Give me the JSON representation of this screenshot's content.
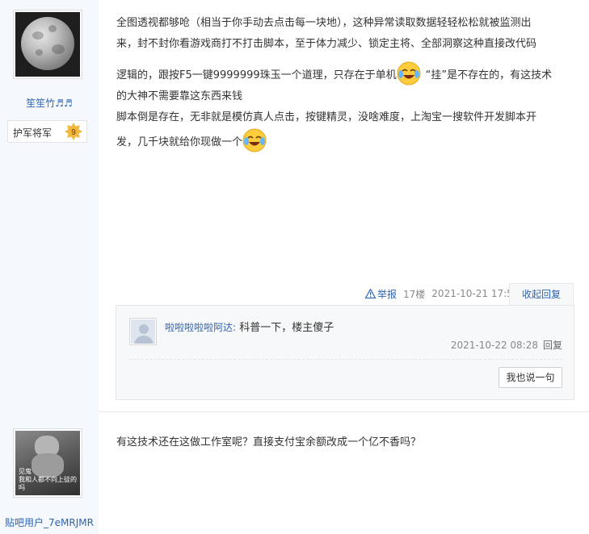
{
  "post1": {
    "username": "笙笙竹♬♬",
    "rank_title": "护军将军",
    "rank_level": "9",
    "lines": [
      "全图透视都够呛（相当于你手动去点击每一块地），这种异常读取数据轻轻松松就被监测出",
      "来，封不封你看游戏商打不打击脚本，至于体力减少、锁定主将、全部洞察这种直接改代码",
      "逻辑的，跟按F5一键9999999珠玉一个道理，只存在于单机",
      "“挂”是不存在的，有这技术",
      "的大神不需要靠这东西来钱",
      "脚本倒是存在，无非就是模仿真人点击，按键精灵，没啥难度，上淘宝一搜软件开发脚本开",
      "发，几千块就给你现做一个"
    ],
    "report_label": "举报",
    "floor": "17楼",
    "time": "2021-10-21 17:58",
    "collapse_label": "收起回复",
    "comment": {
      "username": "啦啦啦啦啦阿达:",
      "text": "科普一下，楼主傻子",
      "time": "2021-10-22 08:28",
      "reply_label": "回复"
    },
    "say_button": "我也说一句"
  },
  "post2": {
    "username": "贴吧用户_7eMRJMR",
    "avatar_caption_1": "见鬼",
    "avatar_caption_2": "我和人都不向上徒的吗",
    "line": "有这技术还在这做工作室呢？直接支付宝余额改成一个亿不香吗？"
  },
  "colors": {
    "link": "#2d64b3",
    "sidebar": "#f5f8fc",
    "badge": "#f3b73c"
  }
}
